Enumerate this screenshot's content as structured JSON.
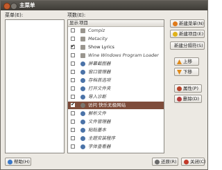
{
  "window": {
    "title": "主菜单"
  },
  "labels": {
    "menus": "菜单(E):",
    "items": "项数(E):"
  },
  "columns": {
    "show": "显示",
    "item": "项目"
  },
  "items": [
    {
      "label": "Compiz",
      "checked": false,
      "icon": "app-icon"
    },
    {
      "label": "Metacity",
      "checked": false,
      "icon": "app-icon"
    },
    {
      "label": "Show Lyrics",
      "checked": true,
      "icon": "lyrics-icon"
    },
    {
      "label": "Wine Windows Program Loader",
      "checked": false,
      "icon": "wine-icon"
    },
    {
      "label": "屏幕截图器",
      "checked": false,
      "icon": "gnome-icon"
    },
    {
      "label": "窗口管理器",
      "checked": false,
      "icon": "gnome-icon"
    },
    {
      "label": "存档首选项",
      "checked": false,
      "icon": "gnome-icon"
    },
    {
      "label": "打开文件夹",
      "checked": false,
      "icon": "gnome-icon"
    },
    {
      "label": "导入诊断",
      "checked": false,
      "icon": "gnome-icon"
    },
    {
      "label": "访问 快乐无极网站",
      "checked": true,
      "icon": "globe-icon",
      "selected": true
    },
    {
      "label": "解析文件",
      "checked": false,
      "icon": "gnome-icon"
    },
    {
      "label": "文件管理器",
      "checked": false,
      "icon": "gnome-icon"
    },
    {
      "label": "粘贴基本",
      "checked": false,
      "icon": "gnome-icon"
    },
    {
      "label": "主题安装程序",
      "checked": false,
      "icon": "gnome-icon"
    },
    {
      "label": "字体查看器",
      "checked": false,
      "icon": "gnome-icon"
    }
  ],
  "buttons": {
    "new_menu": "新建菜单(N)",
    "new_item": "新建项目(E)",
    "new_separator": "新建分隔符(S)",
    "move_up": "上移",
    "move_down": "下移",
    "properties": "属性(P)",
    "delete": "删除(D)",
    "help": "帮助(H)",
    "revert": "还原(R)",
    "close": "关闭(C)"
  },
  "colors": {
    "selection": "#7e4c3b",
    "titlebar": "#4a4741"
  }
}
